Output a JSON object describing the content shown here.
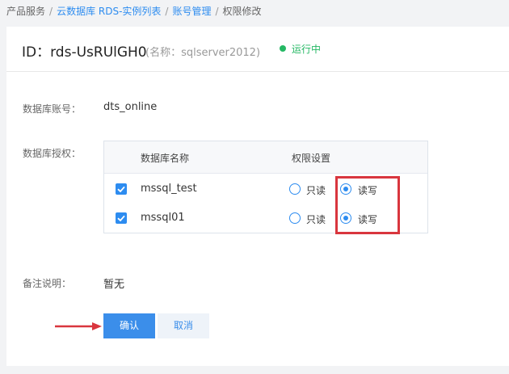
{
  "breadcrumb": {
    "items": [
      "产品服务",
      "云数据库 RDS-实例列表",
      "账号管理",
      "权限修改"
    ]
  },
  "header": {
    "id_text": "ID：rds-UsRUlGH0",
    "name_text": "(名称：sqlserver2012)",
    "status": "运行中"
  },
  "form": {
    "account_label": "数据库账号：",
    "account_value": "dts_online",
    "auth_label": "数据库授权：",
    "remark_label": "备注说明：",
    "remark_value": "暂无"
  },
  "table": {
    "col_name": "数据库名称",
    "col_perm": "权限设置",
    "rows": [
      {
        "name": "mssql_test",
        "checked": true,
        "readonly_label": "只读",
        "readwrite_label": "读写",
        "selected": "读写"
      },
      {
        "name": "mssql01",
        "checked": true,
        "readonly_label": "只读",
        "readwrite_label": "读写",
        "selected": "读写"
      }
    ]
  },
  "buttons": {
    "confirm": "确认",
    "cancel": "取消"
  },
  "colors": {
    "accent": "#2d8cf0",
    "running": "#25b864",
    "annotation": "#d9363e"
  }
}
